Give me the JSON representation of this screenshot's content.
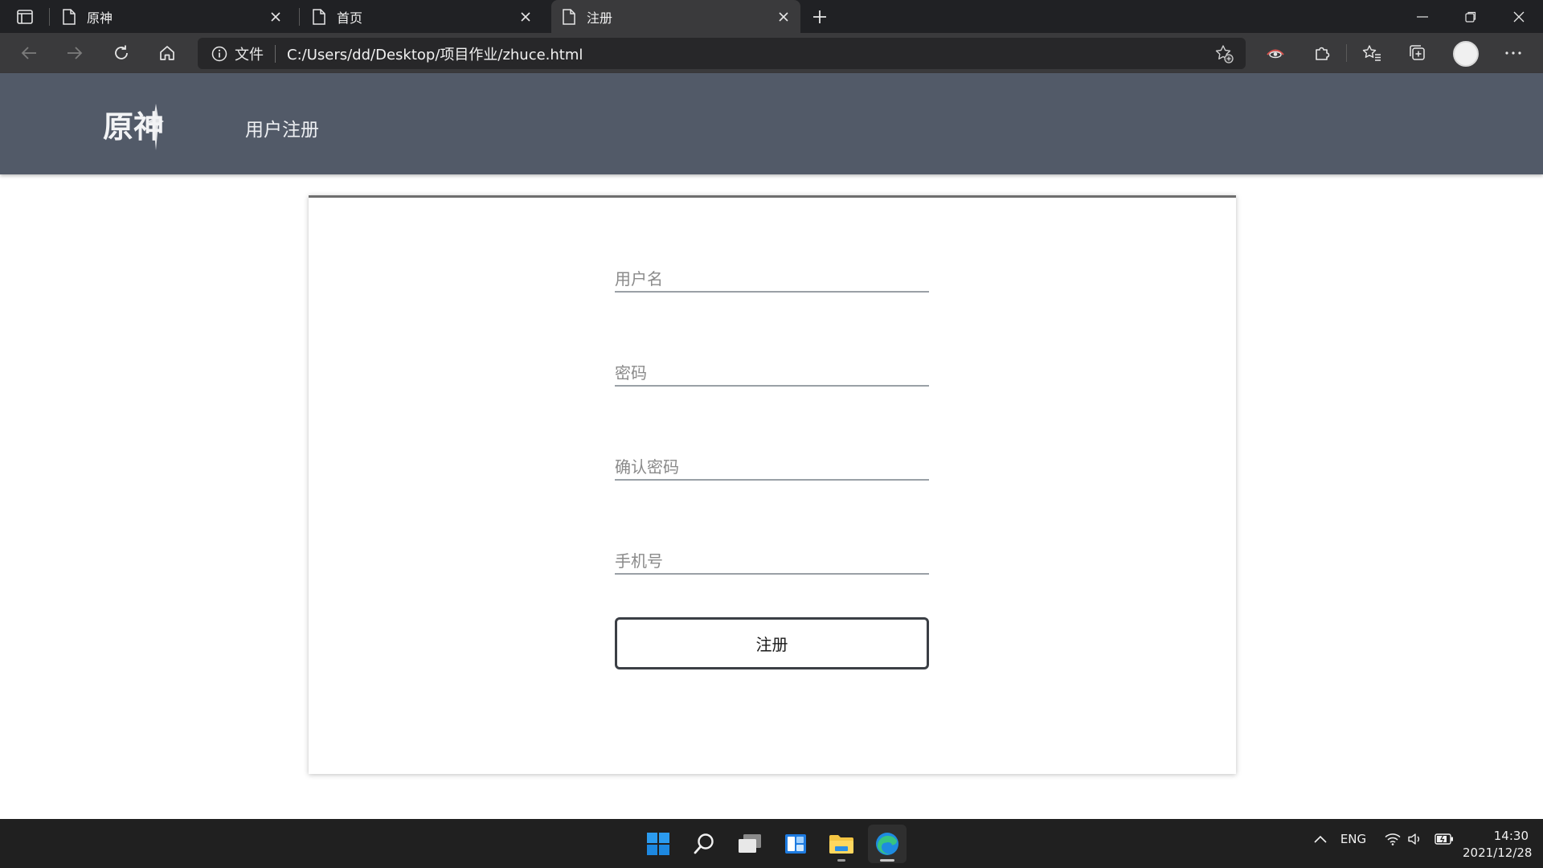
{
  "browser": {
    "tabs": [
      {
        "title": "原神",
        "active": false
      },
      {
        "title": "首页",
        "active": false
      },
      {
        "title": "注册",
        "active": true
      }
    ],
    "address": {
      "security_label": "文件",
      "url": "C:/Users/dd/Desktop/项目作业/zhuce.html"
    }
  },
  "site": {
    "logo_text": "原神",
    "header_title": "用户注册"
  },
  "form": {
    "username_placeholder": "用户名",
    "password_placeholder": "密码",
    "confirm_placeholder": "确认密码",
    "phone_placeholder": "手机号",
    "submit_label": "注册"
  },
  "taskbar": {
    "language": "ENG",
    "time": "14:30",
    "date": "2021/12/28"
  },
  "colors": {
    "header_bg": "#525a68",
    "chrome_dark": "#202124",
    "chrome_toolbar": "#3a3a3c"
  }
}
